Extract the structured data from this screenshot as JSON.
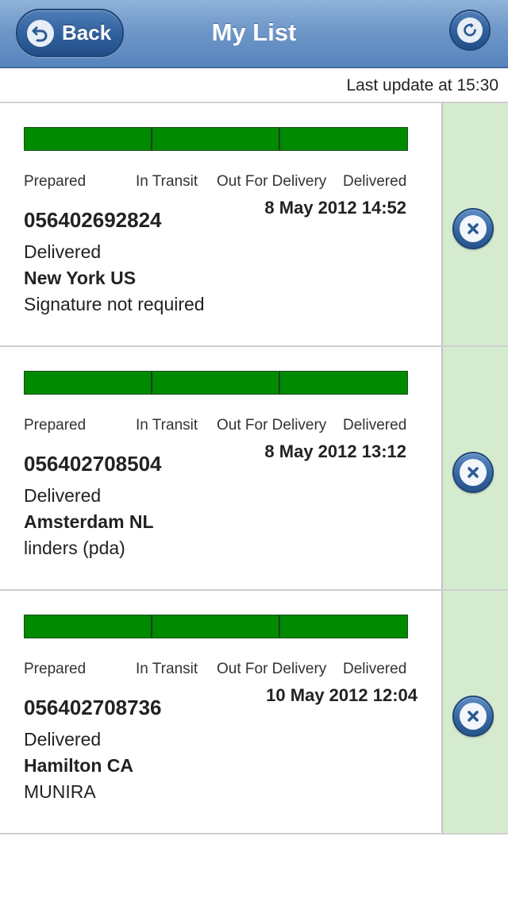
{
  "header": {
    "back_label": "Back",
    "title": "My List",
    "back_icon": "undo-arrow-icon",
    "refresh_icon": "refresh-icon"
  },
  "last_update": "Last update at 15:30",
  "stage_labels": [
    "Prepared",
    "In Transit",
    "Out For Delivery",
    "Delivered"
  ],
  "colors": {
    "progress_complete": "#008a00",
    "delete_column_bg": "#d5ebcf",
    "header_blue": "#6f98c9"
  },
  "shipments": [
    {
      "progress_stage": 4,
      "date": "8 May 2012 14:52",
      "tracking_number": "056402692824",
      "status": "Delivered",
      "location": "New York US",
      "note": "Signature not required",
      "delete_icon": "close-circle-icon"
    },
    {
      "progress_stage": 4,
      "date": "8 May 2012 13:12",
      "tracking_number": "056402708504",
      "status": "Delivered",
      "location": "Amsterdam NL",
      "note": "linders (pda)",
      "delete_icon": "close-circle-icon"
    },
    {
      "progress_stage": 4,
      "date": "10 May 2012 12:04",
      "tracking_number": "056402708736",
      "status": "Delivered",
      "location": "Hamilton CA",
      "note": "MUNIRA",
      "delete_icon": "close-circle-icon"
    }
  ]
}
